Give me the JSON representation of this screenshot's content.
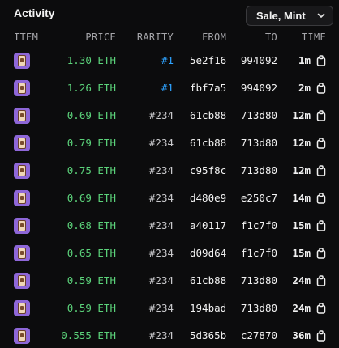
{
  "header": {
    "title": "Activity",
    "filter_label": "Sale, Mint"
  },
  "columns": {
    "item": "ITEM",
    "price": "PRICE",
    "rarity": "RARITY",
    "from": "FROM",
    "to": "TO",
    "time": "TIME"
  },
  "colors": {
    "price": "#5bd27a",
    "rarity_top": "#2ea3ff",
    "item_bg": "#8e67d8"
  },
  "rows": [
    {
      "price": "1.30 ETH",
      "rarity": "#1",
      "top": true,
      "from": "5e2f16",
      "to": "994092",
      "time": "1m"
    },
    {
      "price": "1.26 ETH",
      "rarity": "#1",
      "top": true,
      "from": "fbf7a5",
      "to": "994092",
      "time": "2m"
    },
    {
      "price": "0.69 ETH",
      "rarity": "#234",
      "top": false,
      "from": "61cb88",
      "to": "713d80",
      "time": "12m"
    },
    {
      "price": "0.79 ETH",
      "rarity": "#234",
      "top": false,
      "from": "61cb88",
      "to": "713d80",
      "time": "12m"
    },
    {
      "price": "0.75 ETH",
      "rarity": "#234",
      "top": false,
      "from": "c95f8c",
      "to": "713d80",
      "time": "12m"
    },
    {
      "price": "0.69 ETH",
      "rarity": "#234",
      "top": false,
      "from": "d480e9",
      "to": "e250c7",
      "time": "14m"
    },
    {
      "price": "0.68 ETH",
      "rarity": "#234",
      "top": false,
      "from": "a40117",
      "to": "f1c7f0",
      "time": "15m"
    },
    {
      "price": "0.65 ETH",
      "rarity": "#234",
      "top": false,
      "from": "d09d64",
      "to": "f1c7f0",
      "time": "15m"
    },
    {
      "price": "0.59 ETH",
      "rarity": "#234",
      "top": false,
      "from": "61cb88",
      "to": "713d80",
      "time": "24m"
    },
    {
      "price": "0.59 ETH",
      "rarity": "#234",
      "top": false,
      "from": "194bad",
      "to": "713d80",
      "time": "24m"
    },
    {
      "price": "0.555 ETH",
      "rarity": "#234",
      "top": false,
      "from": "5d365b",
      "to": "c27870",
      "time": "36m"
    }
  ]
}
